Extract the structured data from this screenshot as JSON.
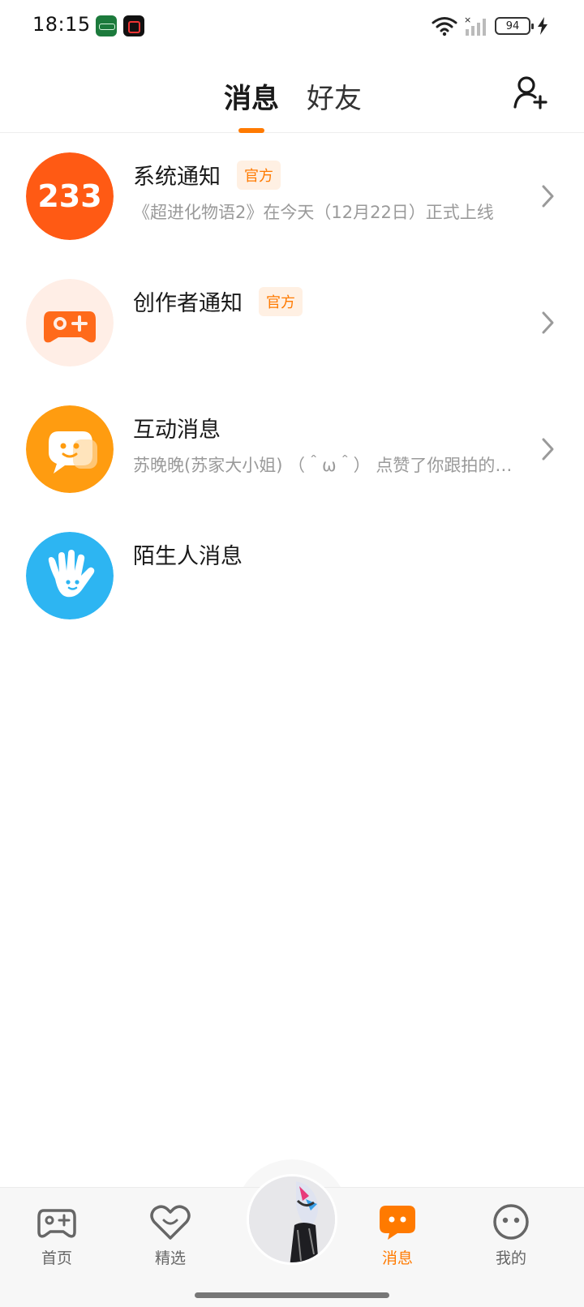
{
  "status_bar": {
    "time": "18:15",
    "battery": "94",
    "icons": [
      "oppo-app-icon",
      "screen-recorder-icon",
      "wifi-icon",
      "signal-icon",
      "battery-icon",
      "charging-bolt-icon"
    ]
  },
  "header": {
    "tabs": [
      {
        "label": "消息",
        "active": true
      },
      {
        "label": "好友",
        "active": false
      }
    ],
    "add_friend_icon": "add-friend-icon",
    "accent_color": "#ff7a00"
  },
  "messages": [
    {
      "title": "系统通知",
      "badge": "官方",
      "preview": "《超进化物语2》在今天（12月22日）正式上线",
      "icon": "233-logo-icon",
      "color": "#ff5a14"
    },
    {
      "title": "创作者通知",
      "badge": "官方",
      "preview": "",
      "icon": "gamepad-plus-icon",
      "color": "#ffeee6"
    },
    {
      "title": "互动消息",
      "badge": "",
      "preview": "苏晚晚(苏家大小姐) （＾ω＾） 点赞了你跟拍的作品",
      "icon": "chat-bubble-icon",
      "color": "#ff9c10"
    },
    {
      "title": "陌生人消息",
      "badge": "",
      "preview": "",
      "icon": "waving-hand-icon",
      "color": "#2db5f2"
    }
  ],
  "bottom_nav": {
    "items": [
      {
        "label": "首页",
        "icon": "gamepad-icon",
        "active": false
      },
      {
        "label": "精选",
        "icon": "heart-smile-icon",
        "active": false
      },
      {
        "label": "消息",
        "icon": "message-icon",
        "active": true
      },
      {
        "label": "我的",
        "icon": "face-icon",
        "active": false
      }
    ],
    "center_avatar": "character-avatar"
  }
}
